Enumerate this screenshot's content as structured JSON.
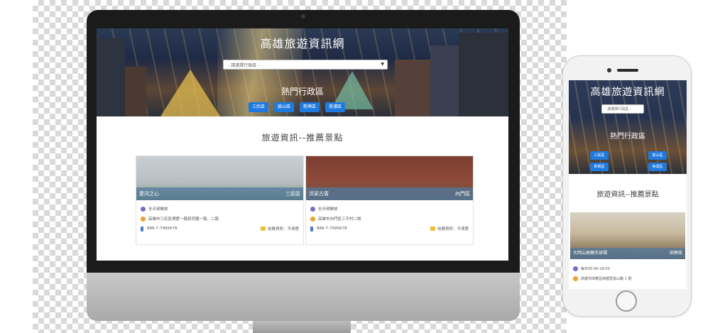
{
  "site": {
    "title": "高雄旅遊資訊網",
    "select_placeholder": "- 請選擇行政區 -",
    "hot_title": "熱門行政區",
    "districts": [
      "三民區",
      "鼓山區",
      "新興區",
      "美濃區"
    ],
    "section_title": "旅遊資訊--推薦景點"
  },
  "cards": [
    {
      "name": "愛河之心",
      "district": "三民區",
      "hours": "全天候開放",
      "address": "高雄市三民區博愛一路和同盟一路、二路",
      "phone": "886-7-7995678",
      "fee": "收費資訊：不清楚"
    },
    {
      "name": "洪家古厝",
      "district": "內門區",
      "hours": "全天候開放",
      "address": "高雄市內門區三平村二號",
      "phone": "886-7-7995678",
      "fee": "收費資訊：不清楚"
    }
  ],
  "mobile": {
    "title": "高雄旅遊資訊網",
    "select_placeholder": "- 請選擇行政區 -",
    "hot_title": "熱門行政區",
    "districts": [
      "三民區",
      "鼓山區",
      "新興區",
      "美濃區"
    ],
    "section_title": "旅遊資訊--推薦景點",
    "card": {
      "name": "大岡山高爾夫球場",
      "district": "田寮區",
      "hours": "每日05:00-18:00",
      "address": "高雄市田寮區西德里長山路 1 號"
    }
  }
}
